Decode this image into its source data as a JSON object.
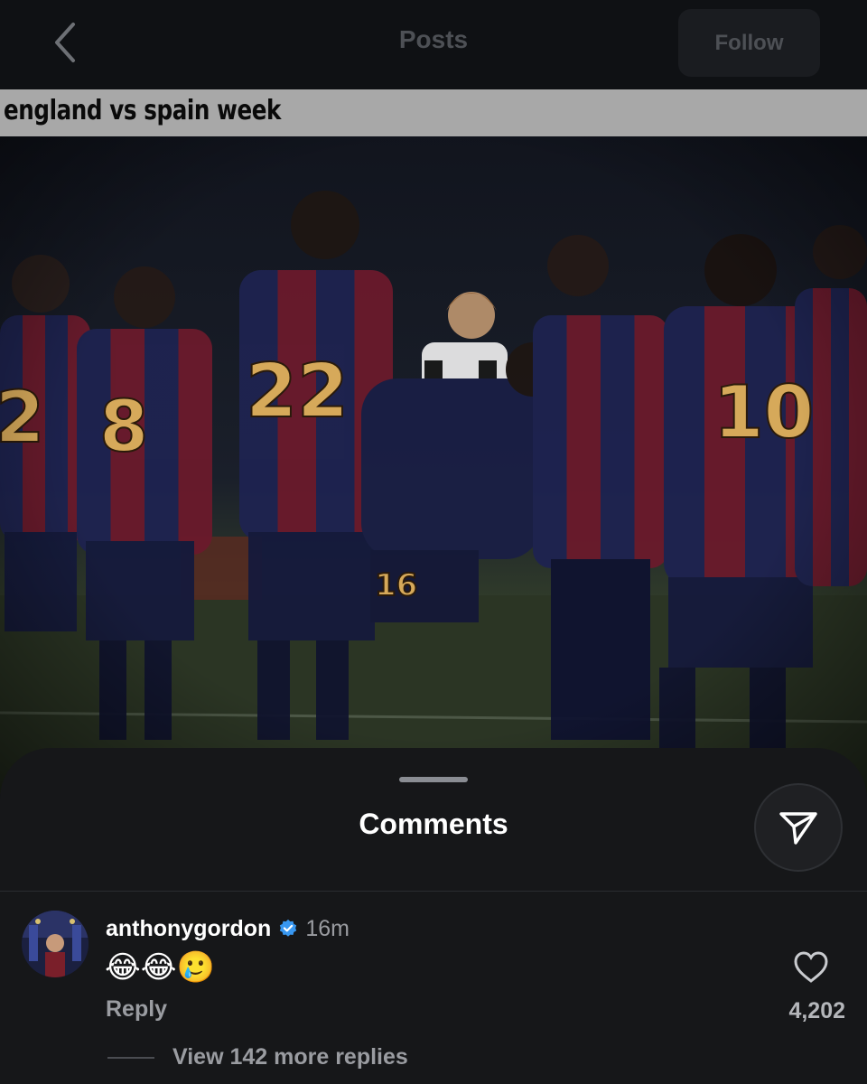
{
  "header": {
    "back_icon": "chevron-left-icon",
    "title": "Posts",
    "follow_label": "Follow"
  },
  "post": {
    "caption": "england vs spain week",
    "jersey_numbers": [
      "2",
      "8",
      "22",
      "10",
      "16"
    ]
  },
  "comments_sheet": {
    "title": "Comments",
    "share_icon": "send-icon",
    "comment": {
      "username": "anthonygordon",
      "verified": true,
      "time": "16m",
      "text": "😂😂🥲",
      "reply_label": "Reply",
      "like_icon": "heart-outline-icon",
      "likes": "4,202",
      "view_replies": "View 142 more replies"
    }
  },
  "colors": {
    "background": "#0d0f12",
    "sheet": "#161719",
    "verified": "#3897f0",
    "caption_bar": "#a8a8a8"
  }
}
